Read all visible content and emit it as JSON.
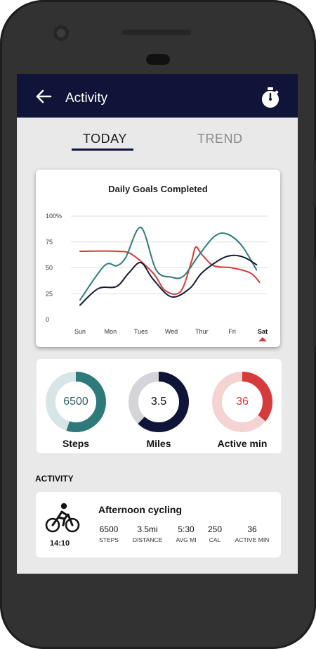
{
  "app": {
    "title": "Activity"
  },
  "tabs": [
    {
      "label": "TODAY",
      "selected": true
    },
    {
      "label": "TREND",
      "selected": false
    }
  ],
  "chart_data": {
    "type": "line",
    "title": "Daily Goals Completed",
    "x": [
      "Sun",
      "Mon",
      "Tues",
      "Wed",
      "Thur",
      "Fri",
      "Sat"
    ],
    "selected_x": "Sat",
    "yticks": [
      "100%",
      "75",
      "50",
      "25",
      "0"
    ],
    "ylim": [
      0,
      100
    ],
    "grid": true,
    "series": [
      {
        "color": "#d63b3b",
        "points": [
          [
            0,
            66
          ],
          [
            1.2,
            66
          ],
          [
            1.7,
            63
          ],
          [
            2.4,
            45
          ],
          [
            2.8,
            28
          ],
          [
            3.3,
            27
          ],
          [
            3.65,
            55
          ],
          [
            3.8,
            70
          ],
          [
            4.0,
            63
          ],
          [
            4.4,
            52
          ],
          [
            5.0,
            50
          ],
          [
            5.6,
            45
          ],
          [
            5.9,
            36
          ]
        ]
      },
      {
        "color": "#2e7a7b",
        "points": [
          [
            0,
            19
          ],
          [
            0.8,
            52
          ],
          [
            1.2,
            52
          ],
          [
            1.5,
            60
          ],
          [
            2.0,
            89
          ],
          [
            2.5,
            48
          ],
          [
            3.0,
            41
          ],
          [
            3.4,
            42
          ],
          [
            3.9,
            62
          ],
          [
            4.4,
            80
          ],
          [
            4.8,
            83
          ],
          [
            5.3,
            72
          ],
          [
            5.8,
            48
          ]
        ]
      },
      {
        "color": "#151a33",
        "points": [
          [
            0,
            14
          ],
          [
            0.6,
            30
          ],
          [
            1.2,
            32
          ],
          [
            1.6,
            45
          ],
          [
            2.0,
            55
          ],
          [
            2.4,
            39
          ],
          [
            3.0,
            22
          ],
          [
            3.6,
            30
          ],
          [
            4.0,
            45
          ],
          [
            4.6,
            58
          ],
          [
            5.0,
            62
          ],
          [
            5.4,
            60
          ],
          [
            5.8,
            53
          ]
        ]
      }
    ]
  },
  "rings": [
    {
      "value": "6500",
      "label": "Steps",
      "fraction": 0.55,
      "color": "#2e7a7b",
      "track": "#d7e5e7",
      "text_color": "#2e5f62"
    },
    {
      "value": "3.5",
      "label": "Miles",
      "fraction": 0.62,
      "color": "#0f1438",
      "track": "#d4d4d9",
      "text_color": "#111"
    },
    {
      "value": "36",
      "label": "Active min",
      "fraction": 0.36,
      "color": "#d63b3b",
      "track": "#f5d3d3",
      "text_color": "#d63b3b"
    }
  ],
  "activity_section": {
    "title": "ACTIVITY"
  },
  "activity": {
    "title": "Afternoon cycling",
    "time": "14:10",
    "icon": "bicycle-icon",
    "metrics": [
      {
        "value": "6500",
        "label": "STEPS"
      },
      {
        "value": "3.5mi",
        "label": "DISTANCE"
      },
      {
        "value": "5:30",
        "label": "AVG MI"
      },
      {
        "value": "250",
        "label": "CAL"
      },
      {
        "value": "36",
        "label": "ACTIVE MIN"
      }
    ]
  }
}
